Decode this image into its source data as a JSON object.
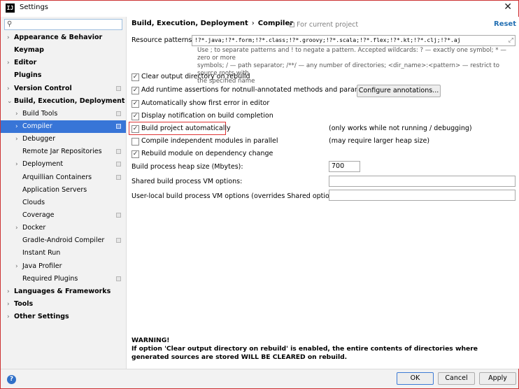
{
  "window": {
    "title": "Settings",
    "app_icon": "IJ",
    "close_glyph": "✕"
  },
  "sidebar": {
    "search_placeholder": "",
    "items": [
      {
        "label": "Appearance & Behavior",
        "arrow": "›",
        "bold": true,
        "indent": 0,
        "proj": false
      },
      {
        "label": "Keymap",
        "arrow": "",
        "bold": true,
        "indent": 0,
        "proj": false
      },
      {
        "label": "Editor",
        "arrow": "›",
        "bold": true,
        "indent": 0,
        "proj": false
      },
      {
        "label": "Plugins",
        "arrow": "",
        "bold": true,
        "indent": 0,
        "proj": false
      },
      {
        "label": "Version Control",
        "arrow": "›",
        "bold": true,
        "indent": 0,
        "proj": true
      },
      {
        "label": "Build, Execution, Deployment",
        "arrow": "⌄",
        "bold": true,
        "indent": 0,
        "proj": false
      },
      {
        "label": "Build Tools",
        "arrow": "›",
        "bold": false,
        "indent": 1,
        "proj": true
      },
      {
        "label": "Compiler",
        "arrow": "›",
        "bold": false,
        "indent": 1,
        "proj": true,
        "selected": true
      },
      {
        "label": "Debugger",
        "arrow": "›",
        "bold": false,
        "indent": 1,
        "proj": false
      },
      {
        "label": "Remote Jar Repositories",
        "arrow": "",
        "bold": false,
        "indent": 1,
        "proj": true
      },
      {
        "label": "Deployment",
        "arrow": "›",
        "bold": false,
        "indent": 1,
        "proj": true
      },
      {
        "label": "Arquillian Containers",
        "arrow": "",
        "bold": false,
        "indent": 1,
        "proj": true
      },
      {
        "label": "Application Servers",
        "arrow": "",
        "bold": false,
        "indent": 1,
        "proj": false
      },
      {
        "label": "Clouds",
        "arrow": "",
        "bold": false,
        "indent": 1,
        "proj": false
      },
      {
        "label": "Coverage",
        "arrow": "",
        "bold": false,
        "indent": 1,
        "proj": true
      },
      {
        "label": "Docker",
        "arrow": "›",
        "bold": false,
        "indent": 1,
        "proj": false
      },
      {
        "label": "Gradle-Android Compiler",
        "arrow": "",
        "bold": false,
        "indent": 1,
        "proj": true
      },
      {
        "label": "Instant Run",
        "arrow": "",
        "bold": false,
        "indent": 1,
        "proj": false
      },
      {
        "label": "Java Profiler",
        "arrow": "›",
        "bold": false,
        "indent": 1,
        "proj": false
      },
      {
        "label": "Required Plugins",
        "arrow": "",
        "bold": false,
        "indent": 1,
        "proj": true
      },
      {
        "label": "Languages & Frameworks",
        "arrow": "›",
        "bold": true,
        "indent": 0,
        "proj": false
      },
      {
        "label": "Tools",
        "arrow": "›",
        "bold": true,
        "indent": 0,
        "proj": false
      },
      {
        "label": "Other Settings",
        "arrow": "›",
        "bold": true,
        "indent": 0,
        "proj": false
      }
    ]
  },
  "header": {
    "breadcrumb_parent": "Build, Execution, Deployment",
    "breadcrumb_sep": "›",
    "breadcrumb_current": "Compiler",
    "for_project": "For current project",
    "reset": "Reset"
  },
  "resource_patterns": {
    "label": "Resource patterns:",
    "value": "!?*.java;!?*.form;!?*.class;!?*.groovy;!?*.scala;!?*.flex;!?*.kt;!?*.clj;!?*.aj",
    "hint_line1": "Use ; to separate patterns and ! to negate a pattern. Accepted wildcards: ? — exactly one symbol; * — zero or more",
    "hint_line2": "symbols; / — path separator; /**/ — any number of directories; <dir_name>:<pattern> — restrict to source roots with",
    "hint_line3": "the specified name"
  },
  "options": {
    "clear_output": {
      "label": "Clear output directory on rebuild",
      "checked": true
    },
    "runtime_assertions": {
      "label": "Add runtime assertions for notnull-annotated methods and parameters",
      "checked": true
    },
    "configure_annotations": "Configure annotations...",
    "show_first_error": {
      "label": "Automatically show first error in editor",
      "checked": true
    },
    "display_notification": {
      "label": "Display notification on build completion",
      "checked": true
    },
    "build_automatically": {
      "label": "Build project automatically",
      "checked": true,
      "note": "(only works while not running / debugging)"
    },
    "compile_parallel": {
      "label": "Compile independent modules in parallel",
      "checked": false,
      "note": "(may require larger heap size)"
    },
    "rebuild_on_change": {
      "label": "Rebuild module on dependency change",
      "checked": true
    }
  },
  "heap": {
    "label": "Build process heap size (Mbytes):",
    "value": "700"
  },
  "shared_vm": {
    "label": "Shared build process VM options:",
    "value": ""
  },
  "user_vm": {
    "label": "User-local build process VM options (overrides Shared options):",
    "value": ""
  },
  "warning": {
    "title": "WARNING!",
    "text": "If option 'Clear output directory on rebuild' is enabled, the entire contents of directories where generated sources are stored WILL BE CLEARED on rebuild."
  },
  "footer": {
    "help": "?",
    "ok": "OK",
    "cancel": "Cancel",
    "apply": "Apply"
  }
}
